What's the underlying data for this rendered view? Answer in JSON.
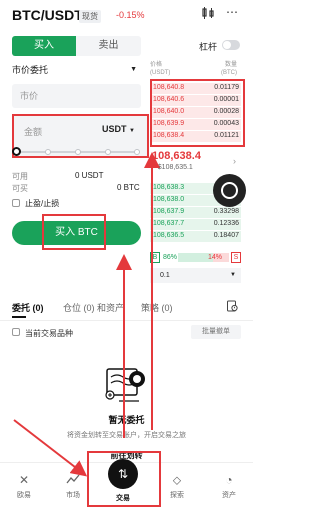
{
  "header": {
    "pair": "BTC/USDT",
    "badge": "现货",
    "change": "-0.15%",
    "icons": [
      "candlestick-icon",
      "more-icon"
    ]
  },
  "trade": {
    "buy_tab": "买入",
    "sell_tab": "卖出",
    "leverage_label": "杠杆",
    "order_type": "市价委托",
    "price_placeholder": "市价",
    "amount_placeholder": "金额",
    "amount_unit": "USDT",
    "available_label": "可用",
    "available_value": "0 USDT",
    "buyable_label": "可买",
    "buyable_value": "0 BTC",
    "tpsl_label": "止盈/止损",
    "buy_button": "买入 BTC"
  },
  "orderbook": {
    "price_header": "价格",
    "price_unit": "(USDT)",
    "qty_header": "数量",
    "qty_unit": "(BTC)",
    "asks": [
      {
        "price": "108,640.8",
        "qty": "0.01179"
      },
      {
        "price": "108,640.6",
        "qty": "0.00001"
      },
      {
        "price": "108,640.0",
        "qty": "0.00028"
      },
      {
        "price": "108,639.9",
        "qty": "0.00043"
      },
      {
        "price": "108,638.4",
        "qty": "0.01121"
      }
    ],
    "last_price": "108,638.4",
    "last_usd": "≈ $108,635.1",
    "bids": [
      {
        "price": "108,638.3",
        "qty": "1"
      },
      {
        "price": "108,638.0",
        "qty": ""
      },
      {
        "price": "108,637.9",
        "qty": "0.33298"
      },
      {
        "price": "108,637.7",
        "qty": "0.12336"
      },
      {
        "price": "108,636.5",
        "qty": "0.18407"
      }
    ],
    "ratio": {
      "buy_letter": "B",
      "buy_pct": "86%",
      "sell_pct": "14%",
      "sell_letter": "S",
      "buy_fraction": 0.86
    },
    "precision": "0.1"
  },
  "orders": {
    "tab_orders": "委托 (0)",
    "tab_positions": "仓位 (0) 和资产",
    "tab_strategy": "策略 (0)",
    "current_pair_label": "当前交易品种",
    "batch_cancel": "批量撤单",
    "empty_title": "暂无委托",
    "empty_desc": "将资金划转至交易账户，开启交易之旅",
    "transfer_link": "前往划转"
  },
  "nav": {
    "items": [
      {
        "label": "欧易",
        "icon": "home-icon"
      },
      {
        "label": "市场",
        "icon": "market-chart-icon"
      },
      {
        "label": "交易",
        "icon": "trade-icon"
      },
      {
        "label": "探索",
        "icon": "explore-icon"
      },
      {
        "label": "资产",
        "icon": "assets-icon"
      }
    ]
  },
  "colors": {
    "buy": "#1aa25a",
    "sell": "#e4393c",
    "annotation": "#e4393c"
  }
}
